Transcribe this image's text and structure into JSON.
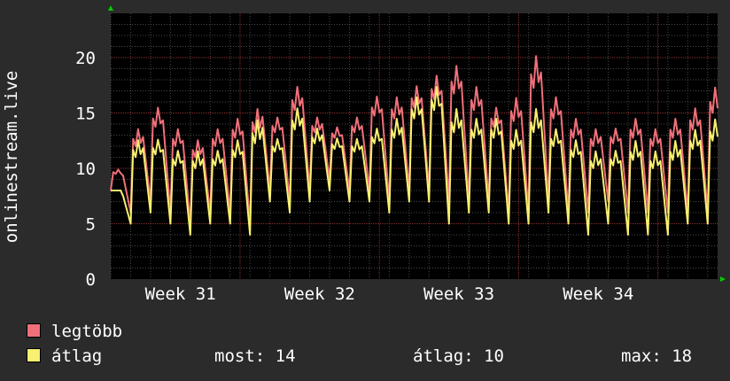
{
  "colors": {
    "background": "#2b2b2b",
    "plot_background": "#000000",
    "grid_minor": "#4a4a4a",
    "grid_major": "#8a3030",
    "max_series": "#f0707a",
    "avg_series": "#f8f070",
    "axis_arrow": "#00cc00",
    "text": "#ffffff"
  },
  "chart_data": {
    "type": "line",
    "ylabel": "onlinestream.live",
    "ylim": [
      0,
      24
    ],
    "yticks": [
      0,
      5,
      10,
      15,
      20
    ],
    "x_range": [
      0,
      30.5
    ],
    "xticks": [
      {
        "label": "Week 31",
        "x": 3.5
      },
      {
        "label": "Week 32",
        "x": 10.5
      },
      {
        "label": "Week 33",
        "x": 17.5
      },
      {
        "label": "Week 34",
        "x": 24.5
      }
    ],
    "x_major_grid": [
      6.5,
      13.5,
      20.5,
      27.5
    ],
    "grid": true,
    "series": [
      {
        "name": "legtöbb",
        "color": "#f0707a",
        "daily_peaks": [
          10,
          14,
          16,
          14,
          13,
          14,
          15,
          16,
          15,
          18,
          15,
          14,
          15,
          17,
          17,
          18,
          19,
          20,
          18,
          16,
          17,
          21,
          17,
          15,
          14,
          14,
          15,
          14,
          15,
          16,
          18
        ],
        "daily_lows": [
          8,
          6,
          7,
          6,
          5,
          6,
          6,
          5,
          8,
          7,
          8,
          9,
          8,
          8,
          7,
          8,
          8,
          7,
          7,
          7,
          6,
          6,
          7,
          6,
          6,
          7,
          6,
          6,
          6,
          6,
          6
        ]
      },
      {
        "name": "átlag",
        "color": "#f8f070",
        "daily_peaks": [
          8,
          13,
          13,
          12,
          12,
          12,
          13,
          15,
          13,
          16,
          14,
          13,
          13,
          14,
          15,
          17,
          18,
          16,
          15,
          15,
          14,
          16,
          14,
          13,
          12,
          12,
          13,
          12,
          13,
          14,
          15
        ],
        "daily_lows": [
          8,
          5,
          6,
          5,
          4,
          5,
          5,
          4,
          7,
          6,
          7,
          8,
          7,
          7,
          6,
          7,
          7,
          5,
          6,
          6,
          5,
          5,
          6,
          5,
          4,
          5,
          4,
          4,
          4,
          5,
          5
        ]
      }
    ]
  },
  "legend": {
    "max_label": "legtöbb",
    "avg_label": "átlag",
    "now": "most: 14",
    "avg": "átlag: 10",
    "max": "max: 18"
  }
}
